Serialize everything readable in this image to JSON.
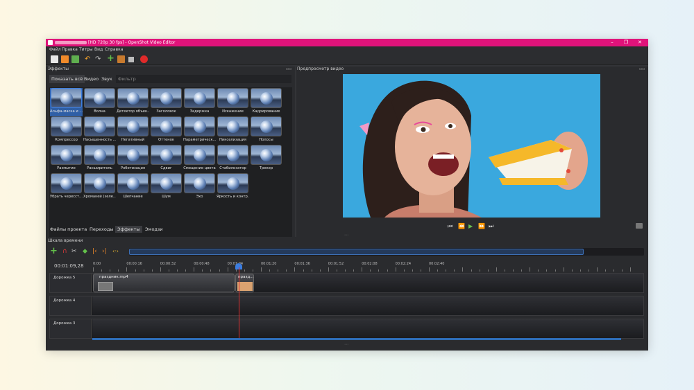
{
  "window": {
    "title": "[HD 720p 30 fps] - OpenShot Video Editor",
    "minimize": "–",
    "maximize": "❐",
    "close": "✕"
  },
  "menu": [
    "Файл",
    "Правка",
    "Титры",
    "Вид",
    "Справка"
  ],
  "effects_panel": {
    "title": "Эффекты",
    "tabs": [
      "Показать всё",
      "Видео",
      "Звук"
    ],
    "filter_placeholder": "Фильтр",
    "items": [
      "Альфа-маска и ...",
      "Волна",
      "Детектор объек...",
      "Заголовок",
      "Задержка",
      "Искажение",
      "Кадрирование",
      "Компрессор",
      "Насыщенность ...",
      "Негативный",
      "Оттенок",
      "Параметрическ...",
      "Пикселизация",
      "Полосы",
      "Размытие",
      "Расширитель",
      "Роботизация",
      "Сдвиг",
      "Смещение цвета",
      "Стабилизатор",
      "Трекер",
      "Убрать чересст...",
      "Хромакей (зеле...",
      "Шепчание",
      "Шум",
      "Эхо",
      "Яркость и контр..."
    ],
    "selected_index": 0
  },
  "bottom_tabs": [
    "Файлы проекта",
    "Переходы",
    "Эффекты",
    "Эмодзи"
  ],
  "preview": {
    "title": "Предпросмотр видео",
    "controls": [
      "⏮",
      "⏪",
      "▶",
      "⏩",
      "⏭"
    ]
  },
  "timeline": {
    "title": "Шкала времени",
    "current_time": "00:01:09,28",
    "ruler_labels": [
      "0:00",
      "00:00:16",
      "00:00:32",
      "00:00:48",
      "00:01:04",
      "00:01:20",
      "00:01:36",
      "00:01:52",
      "00:02:08",
      "00:02:24",
      "00:02:40"
    ],
    "tracks": [
      {
        "name": "Дорожка 5",
        "clips": [
          "праздник.mp4",
          "празд..."
        ]
      },
      {
        "name": "Дорожка 4",
        "clips": []
      },
      {
        "name": "Дорожка 3",
        "clips": []
      }
    ]
  },
  "colors": {
    "titlebar": "#e0137a",
    "accent": "#2f5fa6",
    "playhead": "#e03030"
  }
}
